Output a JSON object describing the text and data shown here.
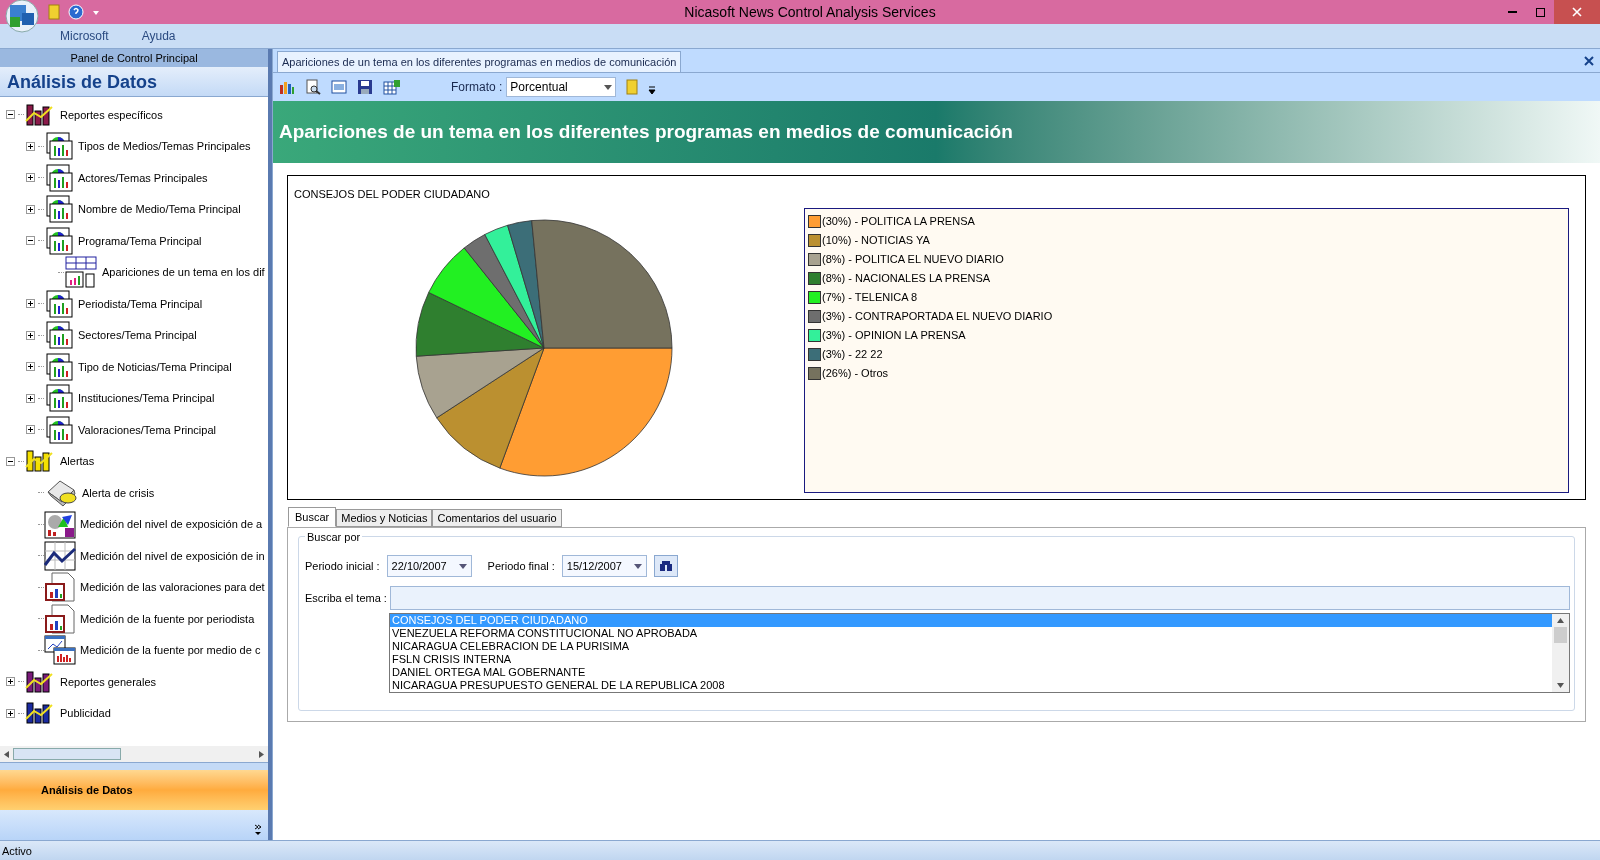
{
  "window": {
    "title": "Nicasoft News Control Analysis Services"
  },
  "menu": [
    "Microsoft",
    "Ayuda"
  ],
  "sidebar": {
    "header": "Panel de Control Principal",
    "title": "Análisis de Datos",
    "tree": [
      {
        "label": "Reportes específicos",
        "kind": "group",
        "color": "#8b1a4a",
        "expanded": true,
        "children": [
          {
            "label": "Tipos de Medios/Temas Principales",
            "kind": "report",
            "expanded": false
          },
          {
            "label": "Actores/Temas Principales",
            "kind": "report",
            "expanded": false
          },
          {
            "label": "Nombre de Medio/Tema Principal",
            "kind": "report",
            "expanded": false
          },
          {
            "label": "Programa/Tema Principal",
            "kind": "report",
            "expanded": true,
            "children": [
              {
                "label": "Apariciones de un tema en los dif",
                "kind": "view"
              }
            ]
          },
          {
            "label": "Periodista/Tema Principal",
            "kind": "report",
            "expanded": false
          },
          {
            "label": "Sectores/Tema Principal",
            "kind": "report",
            "expanded": false
          },
          {
            "label": "Tipo de Noticias/Tema Principal",
            "kind": "report",
            "expanded": false
          },
          {
            "label": "Instituciones/Tema Principal",
            "kind": "report",
            "expanded": false
          },
          {
            "label": "Valoraciones/Tema Principal",
            "kind": "report",
            "expanded": false
          }
        ]
      },
      {
        "label": "Alertas",
        "kind": "group",
        "color": "#f5e000",
        "expanded": true,
        "children": [
          {
            "label": "Alerta de crisis",
            "kind": "phone"
          },
          {
            "label": "Medición del nivel de exposición de a",
            "kind": "mixed"
          },
          {
            "label": "Medición del nivel de exposición de in",
            "kind": "line"
          },
          {
            "label": "Medición de las valoraciones para det",
            "kind": "doc"
          },
          {
            "label": "Medición de la fuente por periodista",
            "kind": "doc"
          },
          {
            "label": "Medición de la fuente por medio de c",
            "kind": "window"
          }
        ]
      },
      {
        "label": "Reportes generales",
        "kind": "group",
        "color": "#7a1a7a",
        "expanded": false
      },
      {
        "label": "Publicidad",
        "kind": "group",
        "color": "#1a2aa0",
        "expanded": false
      }
    ],
    "nav_button": "Análisis de Datos"
  },
  "document_tab": {
    "title": "Apariciones de un tema en los diferentes programas en medios de comunicación"
  },
  "toolbar": {
    "format_label": "Formato :",
    "format_value": "Porcentual"
  },
  "banner": "Apariciones de un tema en los diferentes programas en medios de comunicación",
  "chart_data": {
    "type": "pie",
    "title": "CONSEJOS DEL PODER CIUDADANO",
    "categories": [
      "(30%) - POLITICA LA PRENSA",
      "(10%) - NOTICIAS YA",
      "(8%) - POLITICA EL NUEVO DIARIO",
      "(8%) - NACIONALES LA PRENSA",
      "(7%) - TELENICA 8",
      "(3%) - CONTRAPORTADA EL NUEVO DIARIO",
      "(3%) - OPINION LA PRENSA",
      "(3%) - 22 22",
      "(26%) - Otros"
    ],
    "values": [
      30,
      10,
      8,
      8,
      7,
      3,
      3,
      3,
      26
    ],
    "legend": "right",
    "colors": [
      "#ff9d33",
      "#bb9030",
      "#a8a290",
      "#2f7f2f",
      "#22f022",
      "#6e6e6e",
      "#33f09a",
      "#3c6e78",
      "#76725e"
    ]
  },
  "search_tabs": [
    {
      "label": "Buscar",
      "selected": true
    },
    {
      "label": "Medios y Noticias",
      "selected": false
    },
    {
      "label": "Comentarios del usuario",
      "selected": false
    }
  ],
  "search": {
    "group_title": "Buscar por",
    "start_label": "Periodo inicial :",
    "start_value": "22/10/2007",
    "end_label": "Periodo final :",
    "end_value": "15/12/2007",
    "topic_label": "Escriba el tema :",
    "topics": [
      {
        "label": "CONSEJOS DEL PODER CIUDADANO",
        "selected": true
      },
      {
        "label": "VENEZUELA REFORMA CONSTITUCIONAL NO APROBADA",
        "selected": false
      },
      {
        "label": "NICARAGUA CELEBRACION DE LA PURISIMA",
        "selected": false
      },
      {
        "label": "FSLN CRISIS INTERNA",
        "selected": false
      },
      {
        "label": "DANIEL ORTEGA MAL GOBERNANTE",
        "selected": false
      },
      {
        "label": "NICARAGUA PRESUPUESTO GENERAL DE LA REPUBLICA 2008",
        "selected": false
      }
    ]
  },
  "status_bar": "Activo"
}
